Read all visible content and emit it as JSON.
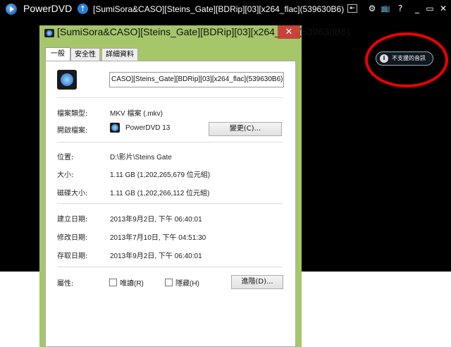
{
  "player": {
    "app_name": "PowerDVD",
    "file_title": "[SumiSora&CASO][Steins_Gate][BDRip][03][x264_flac](539630B6)",
    "notice_text": "不支援的音訊",
    "notice_icon": "info-icon",
    "controls": {
      "back": "⇤",
      "settings": "⚙",
      "tv": "📺",
      "help": "?",
      "minimize": "_",
      "restore": "▭",
      "close": "✕"
    }
  },
  "dialog": {
    "title": "[SumiSora&CASO][Steins_Gate][BDRip][03][x264_flac](539630B6)",
    "close_label": "✕",
    "tabs": [
      {
        "label": "一般"
      },
      {
        "label": "安全性"
      },
      {
        "label": "詳細資料"
      }
    ],
    "file_name": "CASO][Steins_Gate][BDRip][03][x264_flac](539630B6)",
    "type_label": "檔案類型:",
    "type_value": "MKV 檔案 (.mkv)",
    "opens_with_label": "開啟檔案:",
    "opens_with_value": "PowerDVD 13",
    "change_button": "變更(C)...",
    "location_label": "位置:",
    "location_value": "D:\\影片\\Steins Gate",
    "size_label": "大小:",
    "size_value": "1.11 GB (1,202,265,679 位元組)",
    "disk_size_label": "磁碟大小:",
    "disk_size_value": "1.11 GB (1,202,266,112 位元組)",
    "created_label": "建立日期:",
    "created_value": "2013年9月2日, 下午 06:40:01",
    "modified_label": "修改日期:",
    "modified_value": "2013年7月10日, 下午 04:51:30",
    "accessed_label": "存取日期:",
    "accessed_value": "2013年9月2日, 下午 06:40:01",
    "attributes_label": "屬性:",
    "readonly_label": "唯讀(R)",
    "hidden_label": "隱藏(H)",
    "advanced_button": "進階(D)..."
  }
}
